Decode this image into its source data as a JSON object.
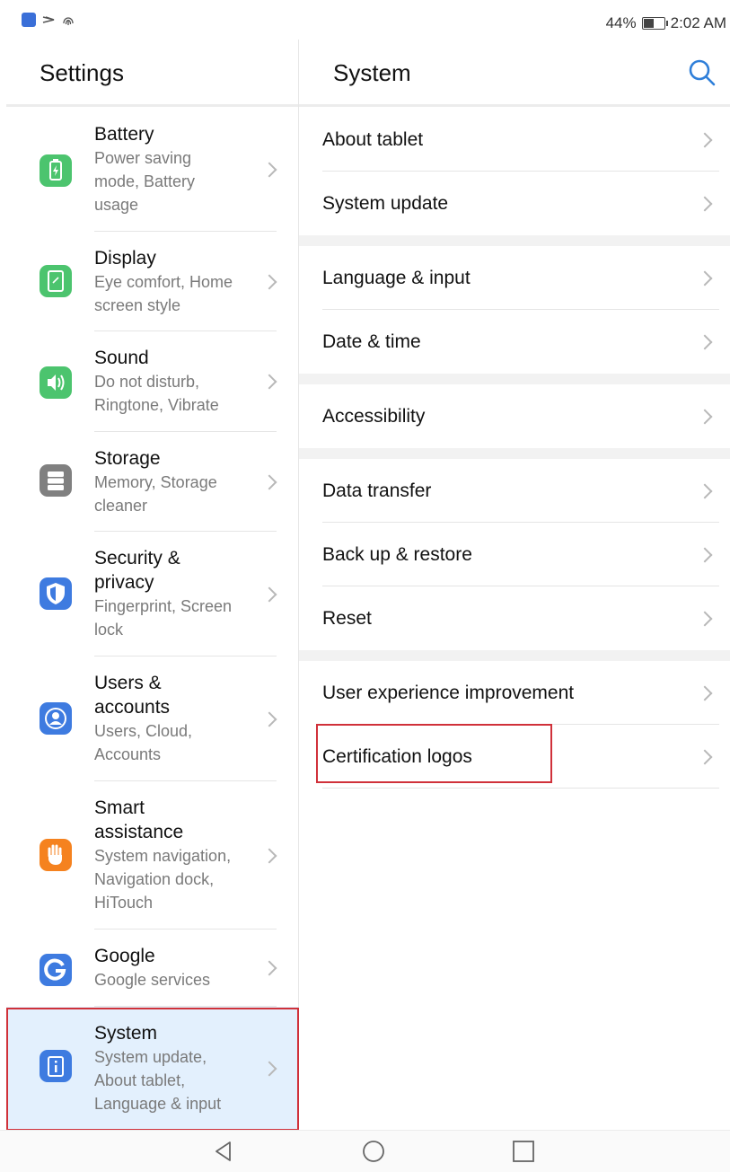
{
  "status_bar": {
    "icons": [
      "app-notification-icon",
      "nfc-icon",
      "fingerprint-icon"
    ],
    "battery_percent": "44%",
    "battery_level": 0.44,
    "time": "2:02 AM"
  },
  "left_pane": {
    "title": "Settings",
    "items": [
      {
        "name": "battery",
        "title": "Battery",
        "subtitle": "Power saving mode, Battery usage",
        "icon": "battery-icon",
        "color": "#4cc46e"
      },
      {
        "name": "display",
        "title": "Display",
        "subtitle": "Eye comfort, Home screen style",
        "icon": "display-icon",
        "color": "#4cc46e"
      },
      {
        "name": "sound",
        "title": "Sound",
        "subtitle": "Do not disturb, Ringtone, Vibrate",
        "icon": "speaker-icon",
        "color": "#4cc46e"
      },
      {
        "name": "storage",
        "title": "Storage",
        "subtitle": "Memory, Storage cleaner",
        "icon": "storage-icon",
        "color": "#808080"
      },
      {
        "name": "security",
        "title": "Security & privacy",
        "subtitle": "Fingerprint, Screen lock",
        "icon": "shield-icon",
        "color": "#3e7be0"
      },
      {
        "name": "users",
        "title": "Users & accounts",
        "subtitle": "Users, Cloud, Accounts",
        "icon": "user-icon",
        "color": "#3e7be0"
      },
      {
        "name": "smart-assistance",
        "title": "Smart assistance",
        "subtitle": "System navigation, Navigation dock, HiTouch",
        "icon": "hand-icon",
        "color": "#f5821f"
      },
      {
        "name": "google",
        "title": "Google",
        "subtitle": "Google services",
        "icon": "google-icon",
        "color": "#3e7be0"
      },
      {
        "name": "system",
        "title": "System",
        "subtitle": "System update, About tablet, Language & input",
        "icon": "info-icon",
        "color": "#3e7be0",
        "selected": true
      }
    ]
  },
  "right_pane": {
    "title": "System",
    "search_icon": "search-icon",
    "groups": [
      [
        "About tablet",
        "System update"
      ],
      [
        "Language & input",
        "Date & time"
      ],
      [
        "Accessibility"
      ],
      [
        "Data transfer",
        "Back up & restore",
        "Reset"
      ],
      [
        "User experience improvement",
        "Certification logos"
      ]
    ]
  },
  "nav_bar": {
    "back": "back-icon",
    "home": "home-icon",
    "recents": "recents-icon"
  },
  "accent_color": "#2f7fd9",
  "highlight_color": "#d0313a"
}
